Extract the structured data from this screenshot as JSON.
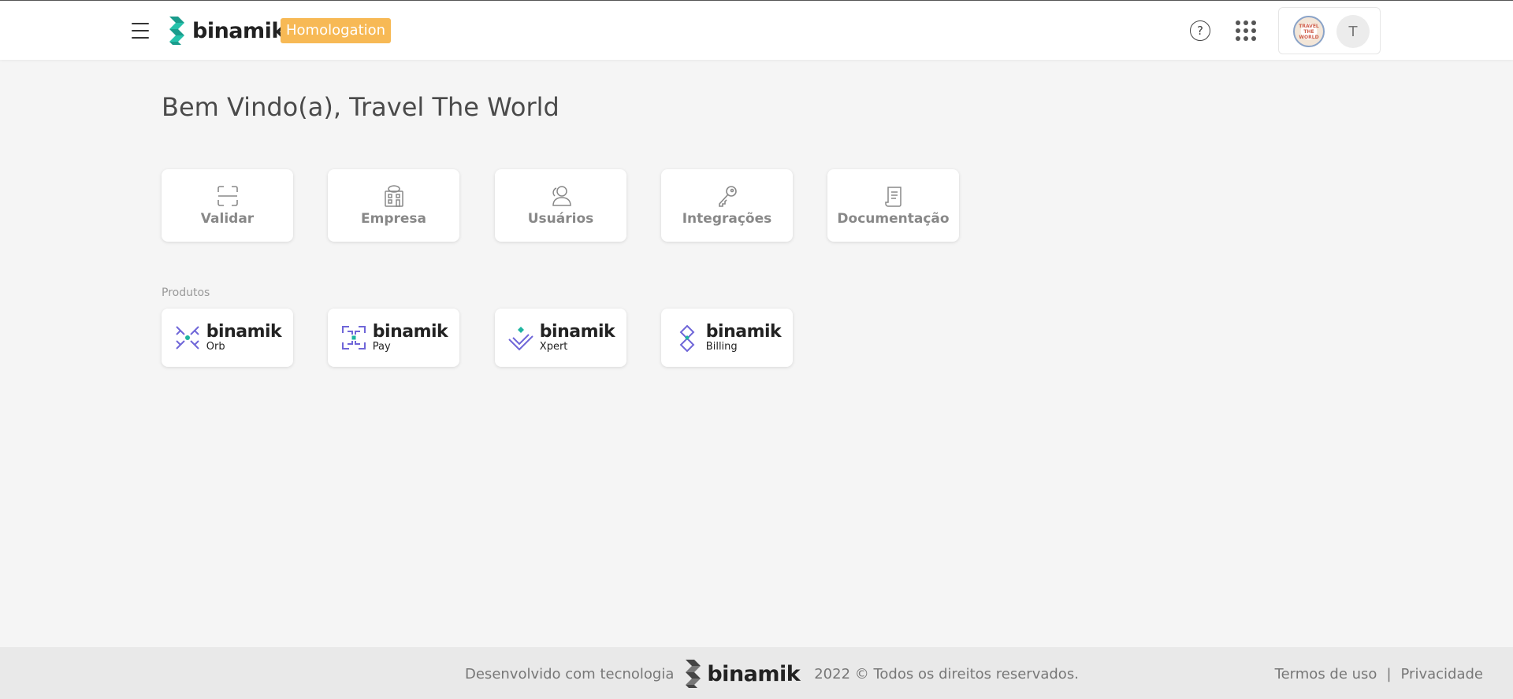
{
  "header": {
    "logo_text": "binamik",
    "env_badge": "Homologation",
    "help_icon": "question-circle-icon",
    "apps_icon": "grid-dots-icon",
    "company_logo_text": "TRAVEL THE WORLD",
    "avatar_initial": "T"
  },
  "main": {
    "welcome": "Bem Vindo(a), Travel The World",
    "shortcuts": [
      {
        "label": "Validar",
        "icon": "scan-frame-icon"
      },
      {
        "label": "Empresa",
        "icon": "building-icon"
      },
      {
        "label": "Usuários",
        "icon": "users-icon"
      },
      {
        "label": "Integrações",
        "icon": "key-icon"
      },
      {
        "label": "Documentação",
        "icon": "document-icon"
      }
    ],
    "products_label": "Produtos",
    "products": [
      {
        "brand": "binamik",
        "sub": "Orb",
        "icon": "orb-mark-icon"
      },
      {
        "brand": "binamik",
        "sub": "Pay",
        "icon": "pay-mark-icon"
      },
      {
        "brand": "binamik",
        "sub": "Xpert",
        "icon": "xpert-mark-icon"
      },
      {
        "brand": "binamik",
        "sub": "Billing",
        "icon": "billing-mark-icon"
      }
    ]
  },
  "footer": {
    "developed_with": "Desenvolvido com tecnologia",
    "logo_text": "binamik",
    "copyright": "2022 © Todos os direitos reservados.",
    "terms": "Termos de uso",
    "separator": "|",
    "privacy": "Privacidade"
  },
  "colors": {
    "accent_badge": "#f7b955",
    "brand_teal": "#1fb5a0",
    "product_purple": "#7b6fe0"
  }
}
